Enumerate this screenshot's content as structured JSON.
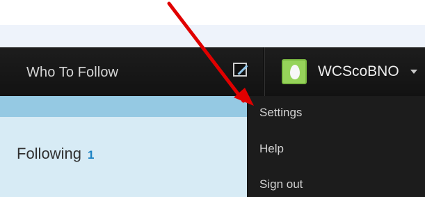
{
  "topbar": {
    "nav_label": "Who To Follow",
    "username": "WCScoBNO",
    "compose_icon": "compose-icon",
    "avatar_icon": "egg-avatar-icon",
    "caret_icon": "chevron-down-icon"
  },
  "profile": {
    "following_label": "Following",
    "following_count": "1"
  },
  "menu": {
    "items": [
      {
        "label": "Settings"
      },
      {
        "label": "Help"
      },
      {
        "label": "Sign out"
      }
    ]
  },
  "colors": {
    "topbar": "#171717",
    "accent": "#1a81c3",
    "panel": "#d7ebf5",
    "arrow": "#e00000"
  }
}
